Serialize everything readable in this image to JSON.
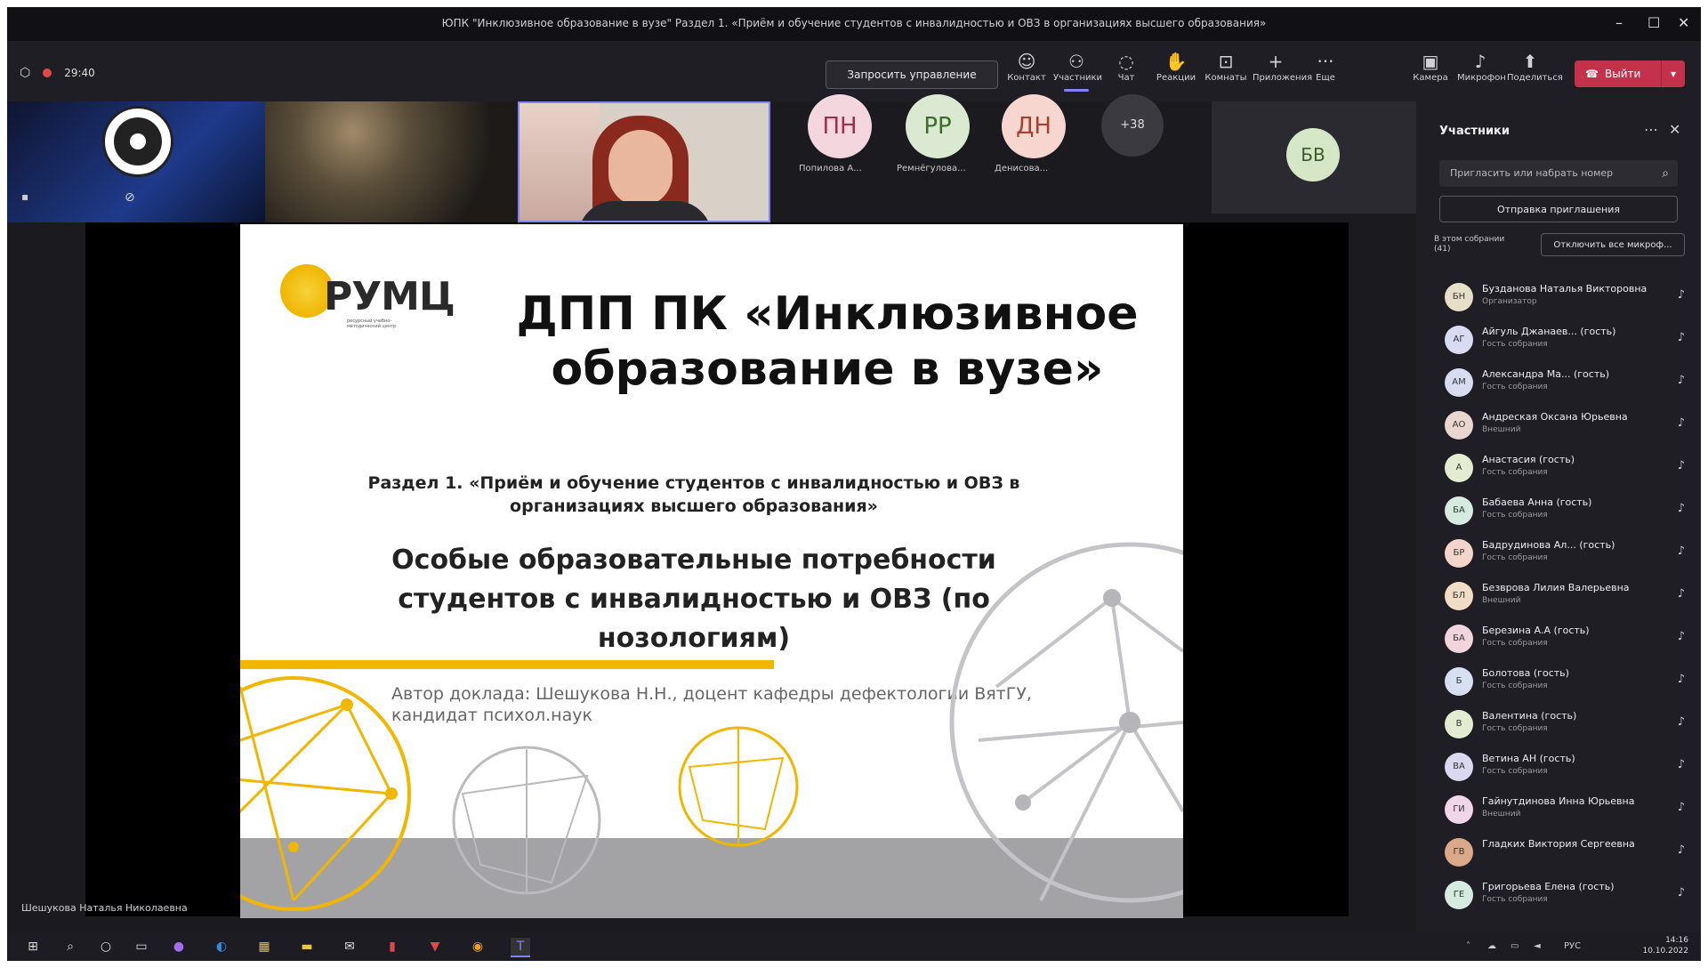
{
  "window": {
    "title": "ЮПК \"Инклюзивное образование в вузе\" Раздел 1. «Приём и обучение студентов с инвалидностью и ОВЗ в организациях высшего образования»",
    "controls": [
      "–",
      "☐",
      "✕"
    ]
  },
  "toolbar": {
    "timer": "29:40",
    "request_control": "Запросить управление",
    "items": [
      {
        "label": "Контакт",
        "icon": "contact-icon"
      },
      {
        "label": "Участники",
        "icon": "participants-icon"
      },
      {
        "label": "Чат",
        "icon": "chat-icon"
      },
      {
        "label": "Реакции",
        "icon": "reactions-icon"
      },
      {
        "label": "Комнаты",
        "icon": "rooms-icon"
      },
      {
        "label": "Приложения",
        "icon": "apps-icon"
      },
      {
        "label": "Еще",
        "icon": "more-icon"
      },
      {
        "label": "Камера",
        "icon": "camera-icon"
      },
      {
        "label": "Микрофон",
        "icon": "mic-icon"
      },
      {
        "label": "Поделиться",
        "icon": "share-icon"
      }
    ],
    "leave": "Выйти"
  },
  "videos": {
    "avatars": [
      {
        "initials": "ПН",
        "name": "Попилова А...",
        "bg": "#f4d6df",
        "fg": "#9c2f52"
      },
      {
        "initials": "РР",
        "name": "Ремнёгулова...",
        "bg": "#dbe9d2",
        "fg": "#3f6b2a"
      },
      {
        "initials": "ДН",
        "name": "Денисова...",
        "bg": "#f6d6cf",
        "fg": "#a8402e"
      }
    ],
    "more_count": "+38",
    "featured": "БВ"
  },
  "slide": {
    "logo": "РУМЦ",
    "logo_sub": "ресурсный учебно-методический центр",
    "title": "ДПП ПК «Инклюзивное образование в вузе»",
    "section": "Раздел 1. «Приём и обучение студентов с инвалидностью и ОВЗ в организациях высшего образования»",
    "subtitle": "Особые образовательные потребности студентов с инвалидностью и ОВЗ (по нозологиям)",
    "author": "Автор доклада: Шешукова Н.Н., доцент кафедры дефектологии ВятГУ, кандидат психол.наук"
  },
  "presenter_name": "Шешукова Наталья Николаевна",
  "panel": {
    "title": "Участники",
    "search_placeholder": "Пригласить или набрать номер",
    "share_invite": "Отправка приглашения",
    "in_meeting": "В этом собрании (41)",
    "mute_all": "Отключить все микроф...",
    "participants": [
      {
        "initials": "БН",
        "name": "Бузданова Наталья Викторовна",
        "role": "Организатор",
        "color": "#e6e0c8"
      },
      {
        "initials": "АГ",
        "name": "Айгуль Джанаев... (гость)",
        "role": "Гость собрания",
        "color": "#d9dbf2"
      },
      {
        "initials": "АМ",
        "name": "Александра Ма... (гость)",
        "role": "Гость собрания",
        "color": "#d8dcf0"
      },
      {
        "initials": "АО",
        "name": "Андреская Оксана Юрьевна",
        "role": "Внешний",
        "color": "#e8d6cf"
      },
      {
        "initials": "А",
        "name": "Анастасия (гость)",
        "role": "Гость собрания",
        "color": "#e3ecd1"
      },
      {
        "initials": "БА",
        "name": "Бабаева Анна (гость)",
        "role": "Гость собрания",
        "color": "#d6ebe0"
      },
      {
        "initials": "БР",
        "name": "Бадрудинова Ал... (гость)",
        "role": "Гость собрания",
        "color": "#f3d5cc"
      },
      {
        "initials": "БЛ",
        "name": "Безврова Лилия Валерьевна",
        "role": "Внешний",
        "color": "#f1dcc5"
      },
      {
        "initials": "БА",
        "name": "Березина А.А (гость)",
        "role": "Гость собрания",
        "color": "#f2d4df"
      },
      {
        "initials": "Б",
        "name": "Болотова (гость)",
        "role": "Гость собрания",
        "color": "#d7dff3"
      },
      {
        "initials": "В",
        "name": "Валентина (гость)",
        "role": "Гость собрания",
        "color": "#e3ecd1"
      },
      {
        "initials": "ВА",
        "name": "Ветина АН (гость)",
        "role": "Гость собрания",
        "color": "#d9d8f0"
      },
      {
        "initials": "ГИ",
        "name": "Гайнутдинова Инна Юрьевна",
        "role": "Внешний",
        "color": "#f0d6e6"
      },
      {
        "initials": "ГВ",
        "name": "Гладких Виктория Сергеевна",
        "role": "",
        "color": "#d9a98a"
      },
      {
        "initials": "ГЕ",
        "name": "Григорьева Елена (гость)",
        "role": "Гость собрания",
        "color": "#d6ebe0"
      }
    ]
  },
  "taskbar": {
    "lang": "РУС",
    "time": "14:16",
    "date": "10.10.2022"
  }
}
